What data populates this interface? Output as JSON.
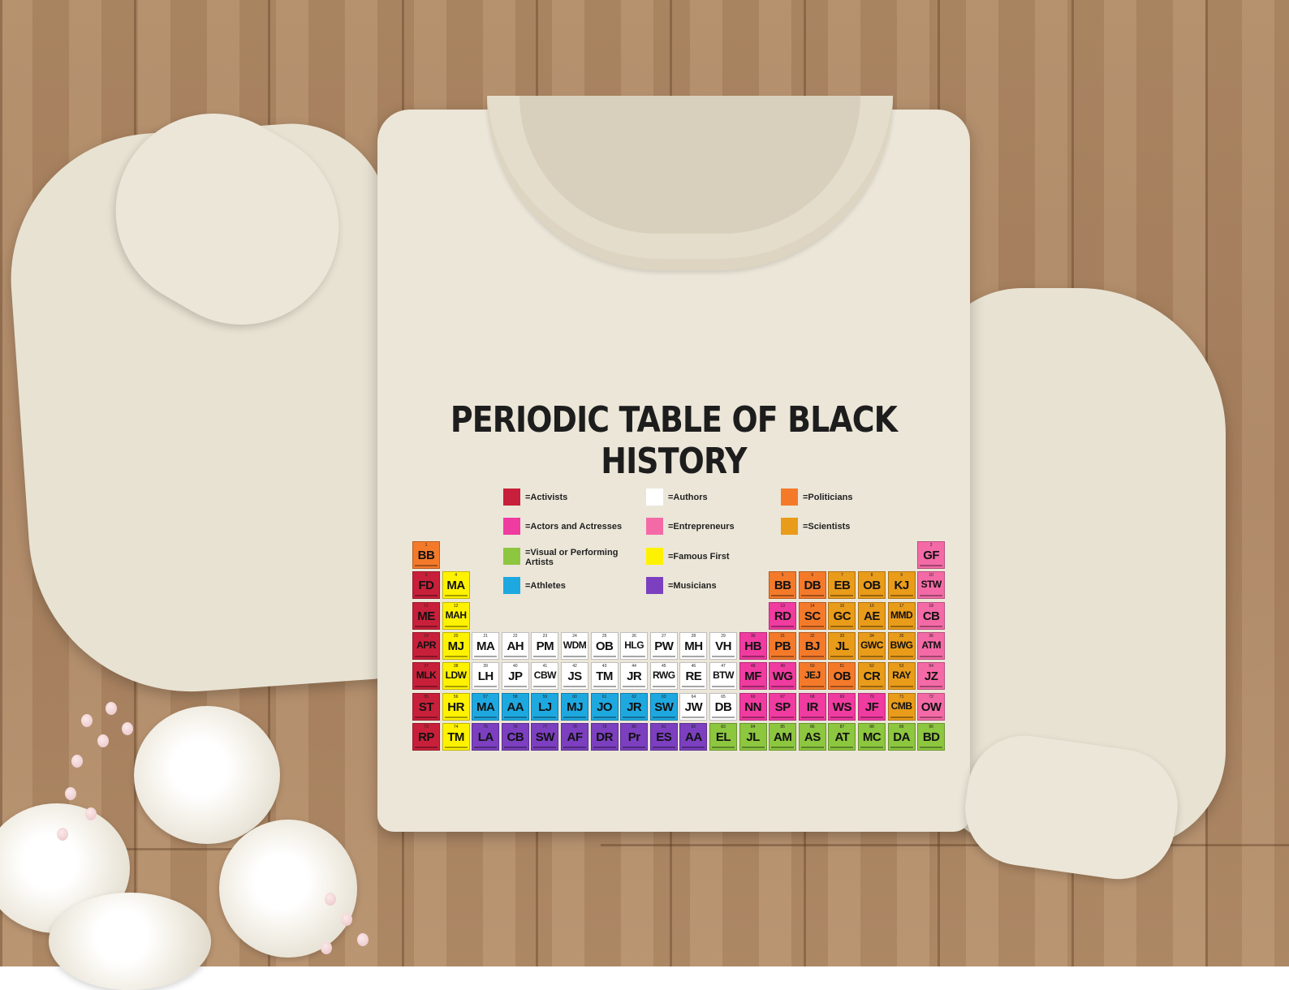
{
  "title": "PERIODIC TABLE OF BLACK HISTORY",
  "colors": {
    "activists": "#c8203a",
    "actors": "#f03ba0",
    "visual": "#8dc63f",
    "athletes": "#1ea8e0",
    "authors": "#ffffff",
    "entrepreneurs": "#f46aa6",
    "famous": "#fff200",
    "musicians": "#7b3fbf",
    "politicians": "#f47a2a",
    "scientists": "#e99b1a"
  },
  "legend": [
    {
      "label": "=Activists",
      "color": "activists"
    },
    {
      "label": "=Actors and Actresses",
      "color": "actors"
    },
    {
      "label": "=Visual or Performing Artists",
      "color": "visual"
    },
    {
      "label": "=Athletes",
      "color": "athletes"
    },
    {
      "label": "=Authors",
      "color": "authors"
    },
    {
      "label": "=Entrepreneurs",
      "color": "entrepreneurs"
    },
    {
      "label": "=Famous First",
      "color": "famous"
    },
    {
      "label": "=Musicians",
      "color": "musicians"
    },
    {
      "label": "=Politicians",
      "color": "politicians"
    },
    {
      "label": "=Scientists",
      "color": "scientists"
    }
  ],
  "table_rows": [
    {
      "cells": [
        {
          "n": "1",
          "s": "BB",
          "c": "politicians",
          "col": 0
        },
        {
          "n": "2",
          "s": "GF",
          "c": "entrepreneurs",
          "col": 17
        }
      ]
    },
    {
      "cells": [
        {
          "n": "3",
          "s": "FD",
          "c": "activists",
          "col": 0
        },
        {
          "n": "4",
          "s": "MA",
          "c": "famous",
          "col": 1
        },
        {
          "n": "5",
          "s": "BB",
          "c": "politicians",
          "col": 12
        },
        {
          "n": "6",
          "s": "DB",
          "c": "politicians",
          "col": 13
        },
        {
          "n": "7",
          "s": "EB",
          "c": "scientists",
          "col": 14
        },
        {
          "n": "8",
          "s": "OB",
          "c": "scientists",
          "col": 15
        },
        {
          "n": "9",
          "s": "KJ",
          "c": "scientists",
          "col": 16
        },
        {
          "n": "10",
          "s": "STW",
          "c": "entrepreneurs",
          "col": 17
        }
      ]
    },
    {
      "cells": [
        {
          "n": "11",
          "s": "ME",
          "c": "activists",
          "col": 0
        },
        {
          "n": "12",
          "s": "MAH",
          "c": "famous",
          "col": 1
        },
        {
          "n": "13",
          "s": "RD",
          "c": "actors",
          "col": 12
        },
        {
          "n": "14",
          "s": "SC",
          "c": "politicians",
          "col": 13
        },
        {
          "n": "15",
          "s": "GC",
          "c": "scientists",
          "col": 14
        },
        {
          "n": "16",
          "s": "AE",
          "c": "scientists",
          "col": 15
        },
        {
          "n": "17",
          "s": "MMD",
          "c": "scientists",
          "col": 16
        },
        {
          "n": "18",
          "s": "CB",
          "c": "entrepreneurs",
          "col": 17
        }
      ]
    },
    {
      "cells": [
        {
          "n": "19",
          "s": "APR",
          "c": "activists",
          "col": 0
        },
        {
          "n": "20",
          "s": "MJ",
          "c": "famous",
          "col": 1
        },
        {
          "n": "21",
          "s": "MA",
          "c": "authors",
          "col": 2
        },
        {
          "n": "22",
          "s": "AH",
          "c": "authors",
          "col": 3
        },
        {
          "n": "23",
          "s": "PM",
          "c": "authors",
          "col": 4
        },
        {
          "n": "24",
          "s": "WDM",
          "c": "authors",
          "col": 5
        },
        {
          "n": "25",
          "s": "OB",
          "c": "authors",
          "col": 6
        },
        {
          "n": "26",
          "s": "HLG",
          "c": "authors",
          "col": 7
        },
        {
          "n": "27",
          "s": "PW",
          "c": "authors",
          "col": 8
        },
        {
          "n": "28",
          "s": "MH",
          "c": "authors",
          "col": 9
        },
        {
          "n": "29",
          "s": "VH",
          "c": "authors",
          "col": 10
        },
        {
          "n": "30",
          "s": "HB",
          "c": "actors",
          "col": 11
        },
        {
          "n": "31",
          "s": "PB",
          "c": "politicians",
          "col": 12
        },
        {
          "n": "32",
          "s": "BJ",
          "c": "politicians",
          "col": 13
        },
        {
          "n": "33",
          "s": "JL",
          "c": "scientists",
          "col": 14
        },
        {
          "n": "34",
          "s": "GWC",
          "c": "scientists",
          "col": 15
        },
        {
          "n": "35",
          "s": "BWG",
          "c": "scientists",
          "col": 16
        },
        {
          "n": "36",
          "s": "ATM",
          "c": "entrepreneurs",
          "col": 17
        }
      ]
    },
    {
      "cells": [
        {
          "n": "37",
          "s": "MLK",
          "c": "activists",
          "col": 0
        },
        {
          "n": "38",
          "s": "LDW",
          "c": "famous",
          "col": 1
        },
        {
          "n": "39",
          "s": "LH",
          "c": "authors",
          "col": 2
        },
        {
          "n": "40",
          "s": "JP",
          "c": "authors",
          "col": 3
        },
        {
          "n": "41",
          "s": "CBW",
          "c": "authors",
          "col": 4
        },
        {
          "n": "42",
          "s": "JS",
          "c": "authors",
          "col": 5
        },
        {
          "n": "43",
          "s": "TM",
          "c": "authors",
          "col": 6
        },
        {
          "n": "44",
          "s": "JR",
          "c": "authors",
          "col": 7
        },
        {
          "n": "45",
          "s": "RWG",
          "c": "authors",
          "col": 8
        },
        {
          "n": "46",
          "s": "RE",
          "c": "authors",
          "col": 9
        },
        {
          "n": "47",
          "s": "BTW",
          "c": "authors",
          "col": 10
        },
        {
          "n": "48",
          "s": "MF",
          "c": "actors",
          "col": 11
        },
        {
          "n": "49",
          "s": "WG",
          "c": "actors",
          "col": 12
        },
        {
          "n": "50",
          "s": "JEJ",
          "c": "politicians",
          "col": 13
        },
        {
          "n": "51",
          "s": "OB",
          "c": "politicians",
          "col": 14
        },
        {
          "n": "52",
          "s": "CR",
          "c": "scientists",
          "col": 15
        },
        {
          "n": "53",
          "s": "RAY",
          "c": "scientists",
          "col": 16
        },
        {
          "n": "54",
          "s": "JZ",
          "c": "entrepreneurs",
          "col": 17
        }
      ]
    },
    {
      "cells": [
        {
          "n": "55",
          "s": "ST",
          "c": "activists",
          "col": 0
        },
        {
          "n": "56",
          "s": "HR",
          "c": "famous",
          "col": 1
        },
        {
          "n": "57",
          "s": "MA",
          "c": "athletes",
          "col": 2
        },
        {
          "n": "58",
          "s": "AA",
          "c": "athletes",
          "col": 3
        },
        {
          "n": "59",
          "s": "LJ",
          "c": "athletes",
          "col": 4
        },
        {
          "n": "60",
          "s": "MJ",
          "c": "athletes",
          "col": 5
        },
        {
          "n": "61",
          "s": "JO",
          "c": "athletes",
          "col": 6
        },
        {
          "n": "62",
          "s": "JR",
          "c": "athletes",
          "col": 7
        },
        {
          "n": "63",
          "s": "SW",
          "c": "athletes",
          "col": 8
        },
        {
          "n": "64",
          "s": "JW",
          "c": "authors",
          "col": 9
        },
        {
          "n": "65",
          "s": "DB",
          "c": "authors",
          "col": 10
        },
        {
          "n": "66",
          "s": "NN",
          "c": "actors",
          "col": 11
        },
        {
          "n": "67",
          "s": "SP",
          "c": "actors",
          "col": 12
        },
        {
          "n": "68",
          "s": "IR",
          "c": "actors",
          "col": 13
        },
        {
          "n": "69",
          "s": "WS",
          "c": "actors",
          "col": 14
        },
        {
          "n": "70",
          "s": "JF",
          "c": "actors",
          "col": 15
        },
        {
          "n": "71",
          "s": "CMB",
          "c": "scientists",
          "col": 16
        },
        {
          "n": "72",
          "s": "OW",
          "c": "entrepreneurs",
          "col": 17
        }
      ]
    },
    {
      "cells": [
        {
          "n": "73",
          "s": "RP",
          "c": "activists",
          "col": 0
        },
        {
          "n": "74",
          "s": "TM",
          "c": "famous",
          "col": 1
        },
        {
          "n": "75",
          "s": "LA",
          "c": "musicians",
          "col": 2
        },
        {
          "n": "76",
          "s": "CB",
          "c": "musicians",
          "col": 3
        },
        {
          "n": "77",
          "s": "SW",
          "c": "musicians",
          "col": 4
        },
        {
          "n": "78",
          "s": "AF",
          "c": "musicians",
          "col": 5
        },
        {
          "n": "79",
          "s": "DR",
          "c": "musicians",
          "col": 6
        },
        {
          "n": "80",
          "s": "Pr",
          "c": "musicians",
          "col": 7
        },
        {
          "n": "81",
          "s": "ES",
          "c": "musicians",
          "col": 8
        },
        {
          "n": "82",
          "s": "AA",
          "c": "musicians",
          "col": 9
        },
        {
          "n": "83",
          "s": "EL",
          "c": "visual",
          "col": 10
        },
        {
          "n": "84",
          "s": "JL",
          "c": "visual",
          "col": 11
        },
        {
          "n": "85",
          "s": "AM",
          "c": "visual",
          "col": 12
        },
        {
          "n": "86",
          "s": "AS",
          "c": "visual",
          "col": 13
        },
        {
          "n": "87",
          "s": "AT",
          "c": "visual",
          "col": 14
        },
        {
          "n": "88",
          "s": "MC",
          "c": "visual",
          "col": 15
        },
        {
          "n": "89",
          "s": "DA",
          "c": "visual",
          "col": 16
        },
        {
          "n": "90",
          "s": "BD",
          "c": "visual",
          "col": 17
        }
      ]
    }
  ]
}
